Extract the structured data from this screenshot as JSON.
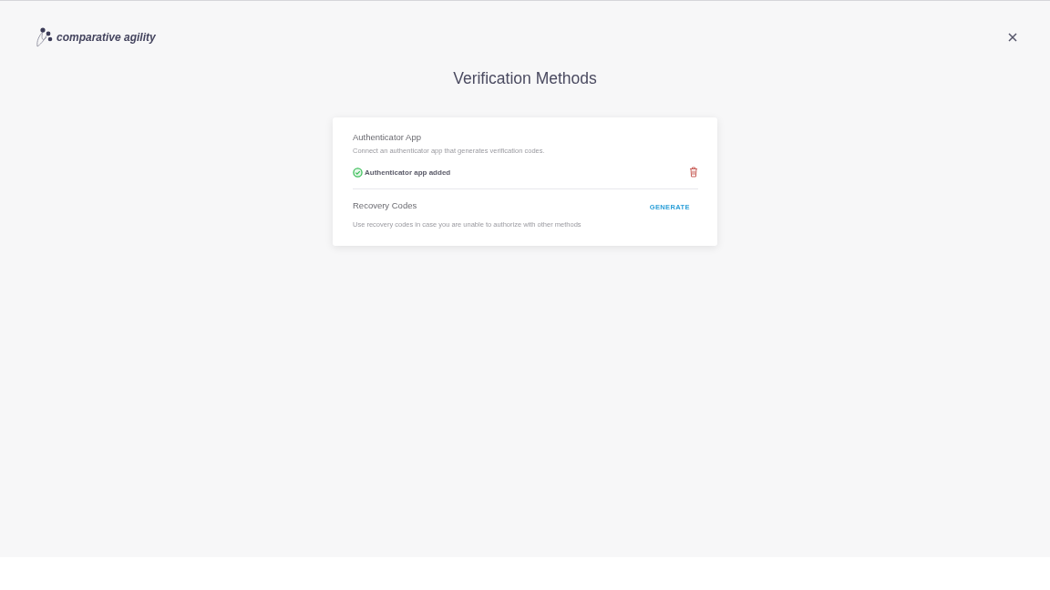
{
  "header": {
    "logo_text": "comparative agility"
  },
  "title": "Verification Methods",
  "methods": [
    {
      "kind": "authenticator",
      "title": "Authenticator App",
      "description": "Connect an authenticator app that generates verification codes.",
      "status": "Authenticator app added"
    },
    {
      "kind": "recovery",
      "title": "Recovery Codes",
      "description": "Use recovery codes in case you are unable to authorize with other methods",
      "action": "GENERATE"
    }
  ]
}
